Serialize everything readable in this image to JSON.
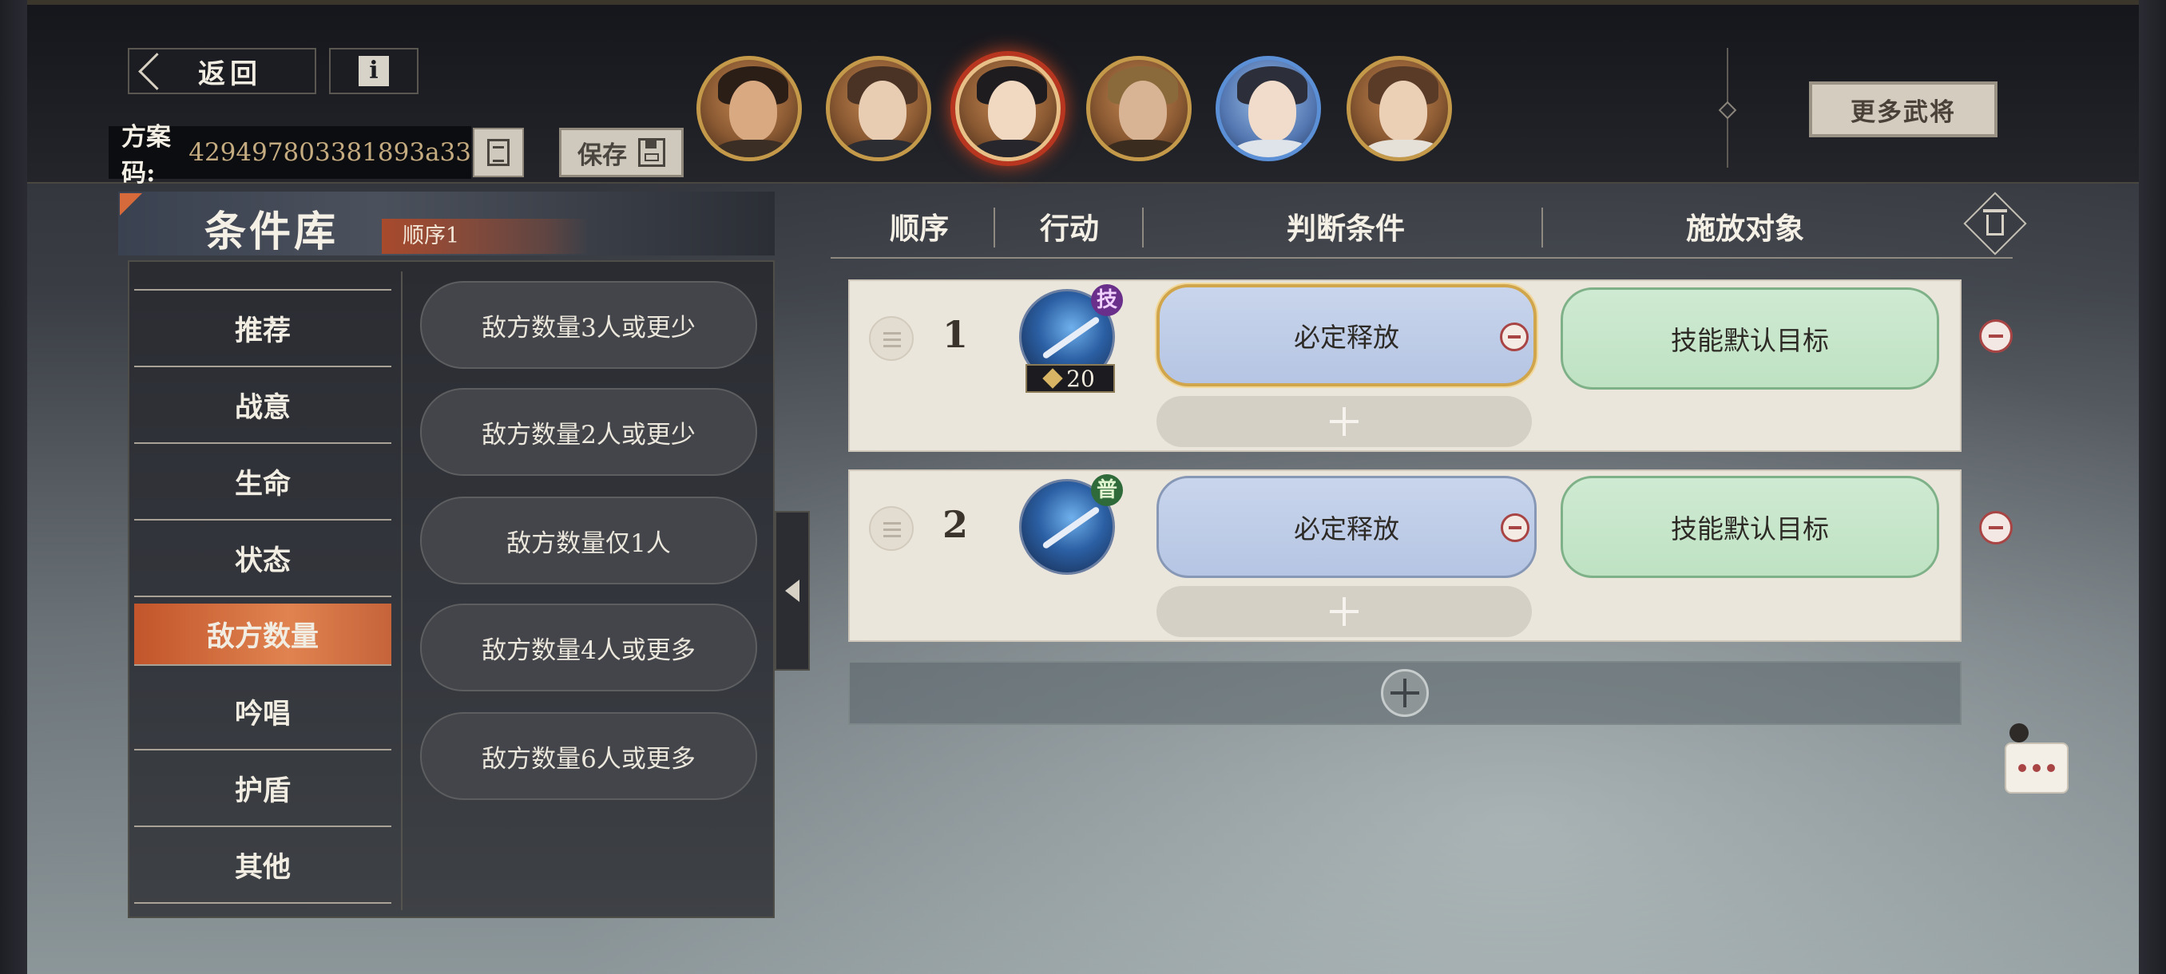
{
  "topbar": {
    "back_label": "返回",
    "info_icon": "info-icon",
    "scheme_label": "方案码:",
    "scheme_code": "429497803381893a33",
    "save_label": "保存",
    "more_generals_label": "更多武将",
    "heroes": [
      {
        "name": "hero-1"
      },
      {
        "name": "hero-2"
      },
      {
        "name": "hero-3",
        "selected": true
      },
      {
        "name": "hero-4"
      },
      {
        "name": "hero-5"
      },
      {
        "name": "hero-6"
      }
    ]
  },
  "condition_library": {
    "title": "条件库",
    "order_tag": "顺序1",
    "categories": [
      "推荐",
      "战意",
      "生命",
      "状态",
      "敌方数量",
      "吟唱",
      "护盾",
      "其他"
    ],
    "active_category": "敌方数量",
    "conditions": [
      "敌方数量3人或更少",
      "敌方数量2人或更少",
      "敌方数量仅1人",
      "敌方数量4人或更多",
      "敌方数量6人或更多"
    ]
  },
  "strategy_table": {
    "headers": {
      "order": "顺序",
      "action": "行动",
      "condition": "判断条件",
      "target": "施放对象"
    },
    "rows": [
      {
        "order": "1",
        "skill_badge": "技",
        "skill_cost": "20",
        "condition": "必定释放",
        "target": "技能默认目标"
      },
      {
        "order": "2",
        "skill_badge": "普",
        "condition": "必定释放",
        "target": "技能默认目标"
      }
    ]
  },
  "colors": {
    "accent_orange": "#d66a3a",
    "condition_blue": "#c9d5ec",
    "target_green": "#cfead2",
    "remove_red": "#a94444",
    "gold_border": "#d1a54c"
  }
}
